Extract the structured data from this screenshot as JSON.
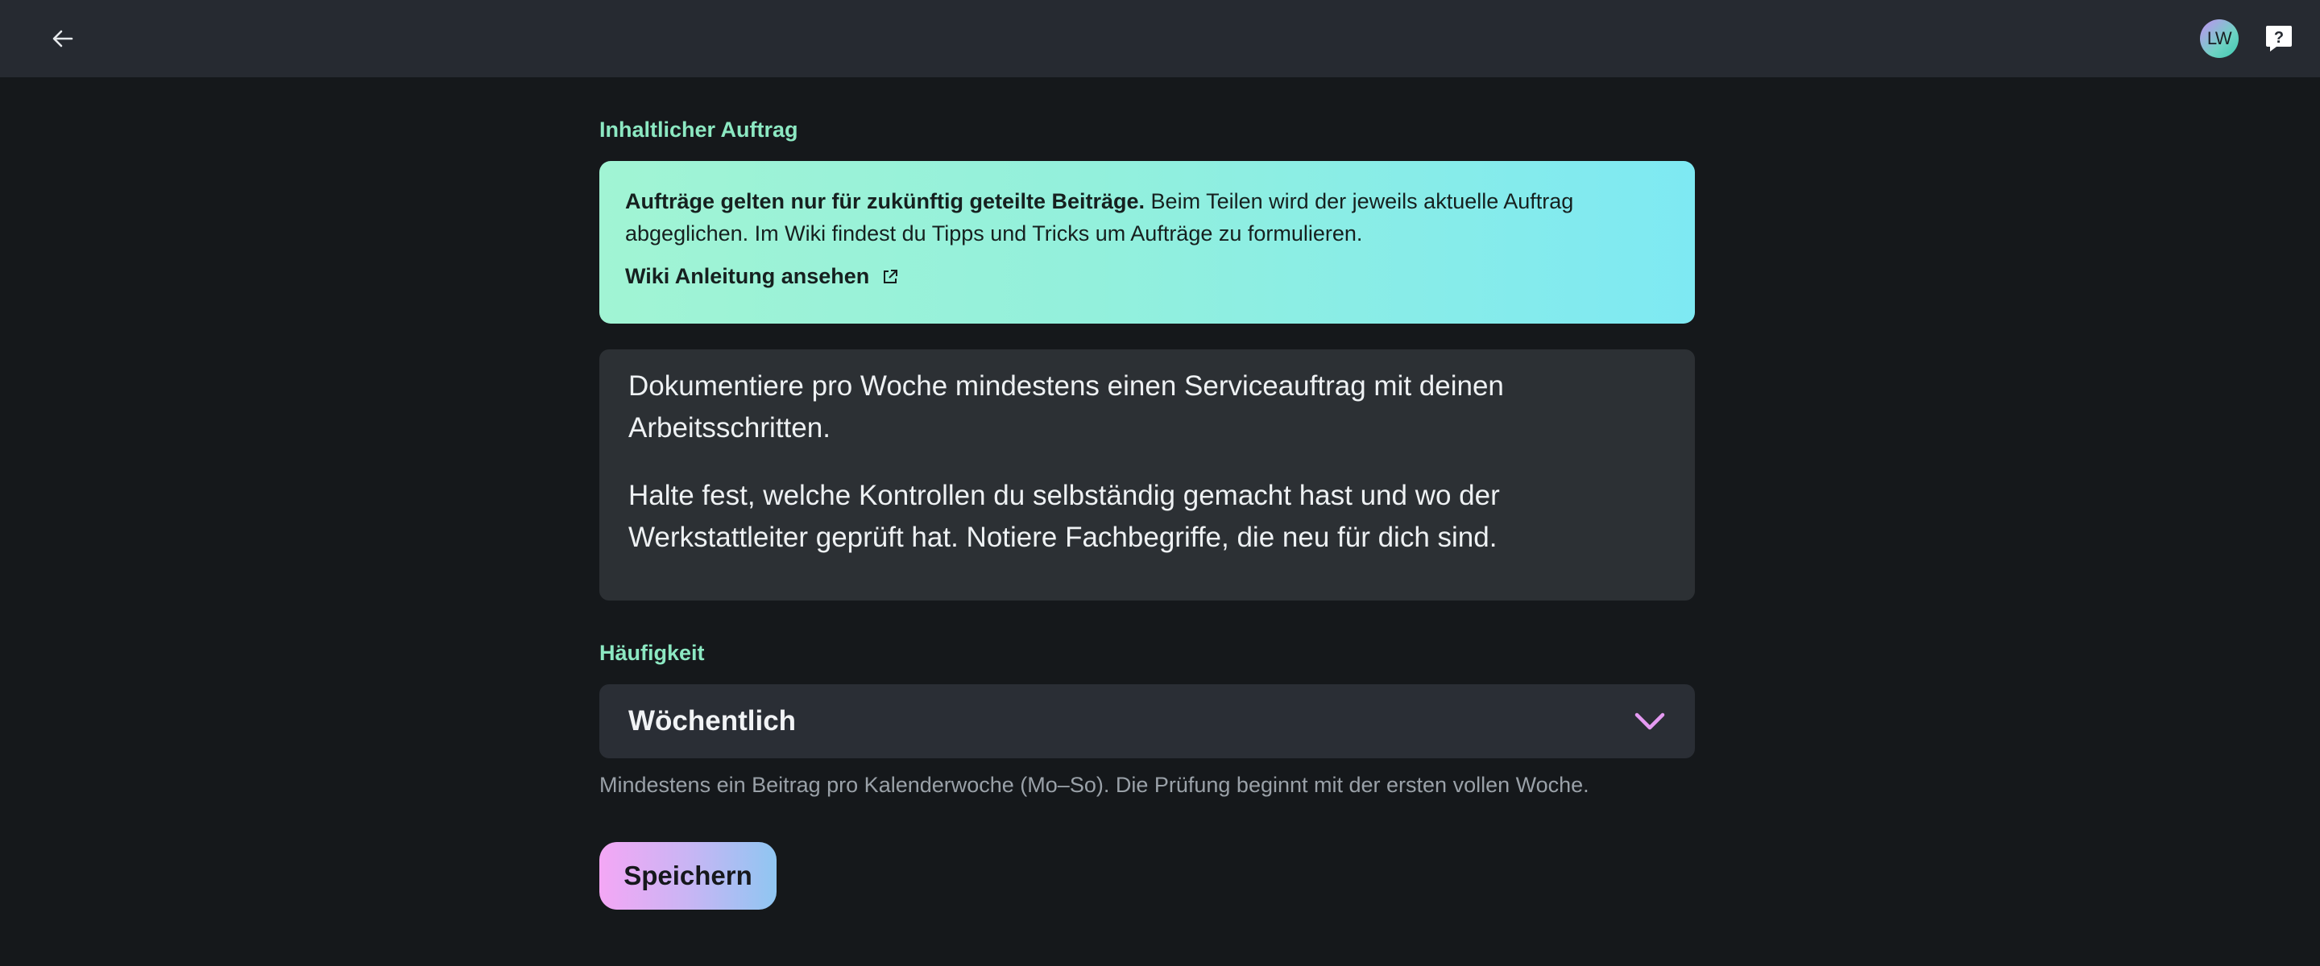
{
  "header": {
    "back_icon": "arrow-left-icon",
    "avatar_initials": "LW",
    "help_icon": "help-speech-bubble-icon"
  },
  "auftrag": {
    "label": "Inhaltlicher Auftrag",
    "info_bold": "Aufträge gelten nur für zukünftig geteilte Beiträge.",
    "info_text": " Beim Teilen wird der jeweils aktuelle Auftrag abgeglichen. Im Wiki findest du Tipps und Tricks um Aufträge zu formulieren.",
    "wiki_link": "Wiki Anleitung ansehen",
    "wiki_icon": "external-link-icon",
    "text_paragraphs": [
      "Dokumentiere pro Woche mindestens einen Serviceauftrag mit deinen Arbeitsschritten.",
      "Halte fest, welche Kontrollen du selbständig gemacht hast und wo der Werkstattleiter geprüft hat. Notiere Fachbegriffe, die neu für dich sind."
    ]
  },
  "frequency": {
    "label": "Häufigkeit",
    "selected": "Wöchentlich",
    "hint": "Mindestens ein Beitrag pro Kalenderwoche (Mo–So). Die Prüfung beginnt mit der ersten vollen Woche."
  },
  "save_label": "Speichern",
  "colors": {
    "accent_green": "#8ce8c2",
    "chevron": "#e59af2",
    "background": "#15181b"
  }
}
